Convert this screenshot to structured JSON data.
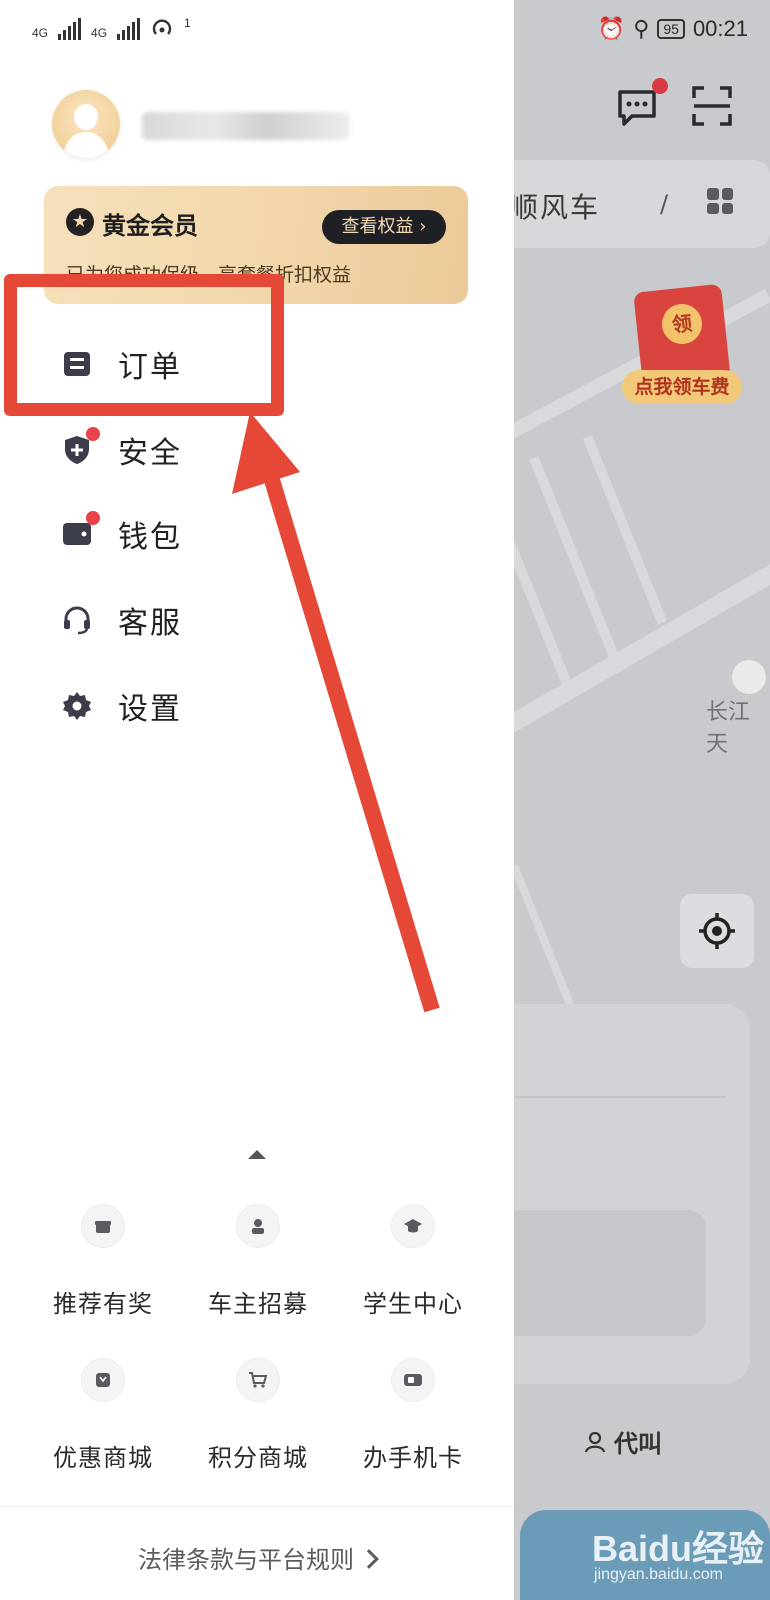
{
  "status_bar": {
    "network_1": "4G",
    "network_2": "4G",
    "hotspot_count": "1",
    "battery": "95",
    "time": "00:21"
  },
  "background": {
    "search_text": "顺风车",
    "search_separator": "/",
    "red_packet_coin": "领",
    "red_packet_label": "点我领车费",
    "place_label": "长江天",
    "daijiao_label": "代叫",
    "watermark": "Baidu经验",
    "watermark_sub": "jingyan.baidu.com"
  },
  "drawer": {
    "member": {
      "title": "黄金会员",
      "button": "查看权益 ›",
      "desc": "已为您成功保级，享套餐折扣权益"
    },
    "menu": [
      {
        "label": "订单",
        "icon": "order-icon",
        "badge": false
      },
      {
        "label": "安全",
        "icon": "shield-plus-icon",
        "badge": true
      },
      {
        "label": "钱包",
        "icon": "wallet-icon",
        "badge": true
      },
      {
        "label": "客服",
        "icon": "headset-icon",
        "badge": false
      },
      {
        "label": "设置",
        "icon": "gear-icon",
        "badge": false
      }
    ],
    "grid": [
      {
        "label": "推荐有奖",
        "icon": "gift-icon"
      },
      {
        "label": "车主招募",
        "icon": "driver-icon"
      },
      {
        "label": "学生中心",
        "icon": "graduation-cap-icon"
      },
      {
        "label": "优惠商城",
        "icon": "coupon-icon"
      },
      {
        "label": "积分商城",
        "icon": "cart-icon"
      },
      {
        "label": "办手机卡",
        "icon": "sim-card-icon"
      }
    ],
    "legal": "法律条款与平台规则"
  },
  "colors": {
    "highlight": "#e64838",
    "badge": "#e8424a",
    "member_gold": "#f3d9ae"
  }
}
